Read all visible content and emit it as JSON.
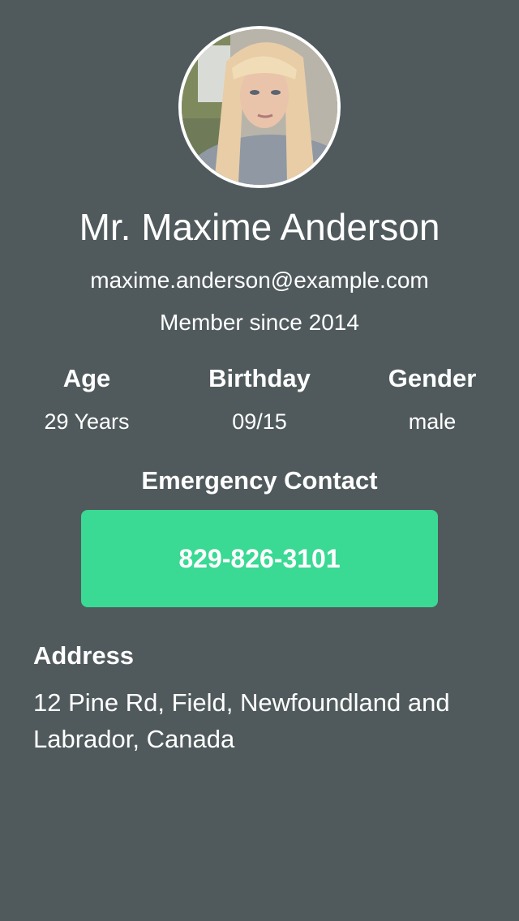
{
  "profile": {
    "name": "Mr. Maxime Anderson",
    "email": "maxime.anderson@example.com",
    "member_since": "Member since 2014"
  },
  "avatar": {
    "icon": "profile-photo"
  },
  "stats": {
    "age": {
      "label": "Age",
      "value": "29 Years"
    },
    "birthday": {
      "label": "Birthday",
      "value": "09/15"
    },
    "gender": {
      "label": "Gender",
      "value": "male"
    }
  },
  "emergency": {
    "label": "Emergency Contact",
    "phone": "829-826-3101"
  },
  "address": {
    "label": "Address",
    "value": "12 Pine Rd, Field, Newfoundland and Labrador, Canada"
  },
  "colors": {
    "background": "#505a5c",
    "accent": "#3ad994",
    "text": "#ffffff"
  }
}
